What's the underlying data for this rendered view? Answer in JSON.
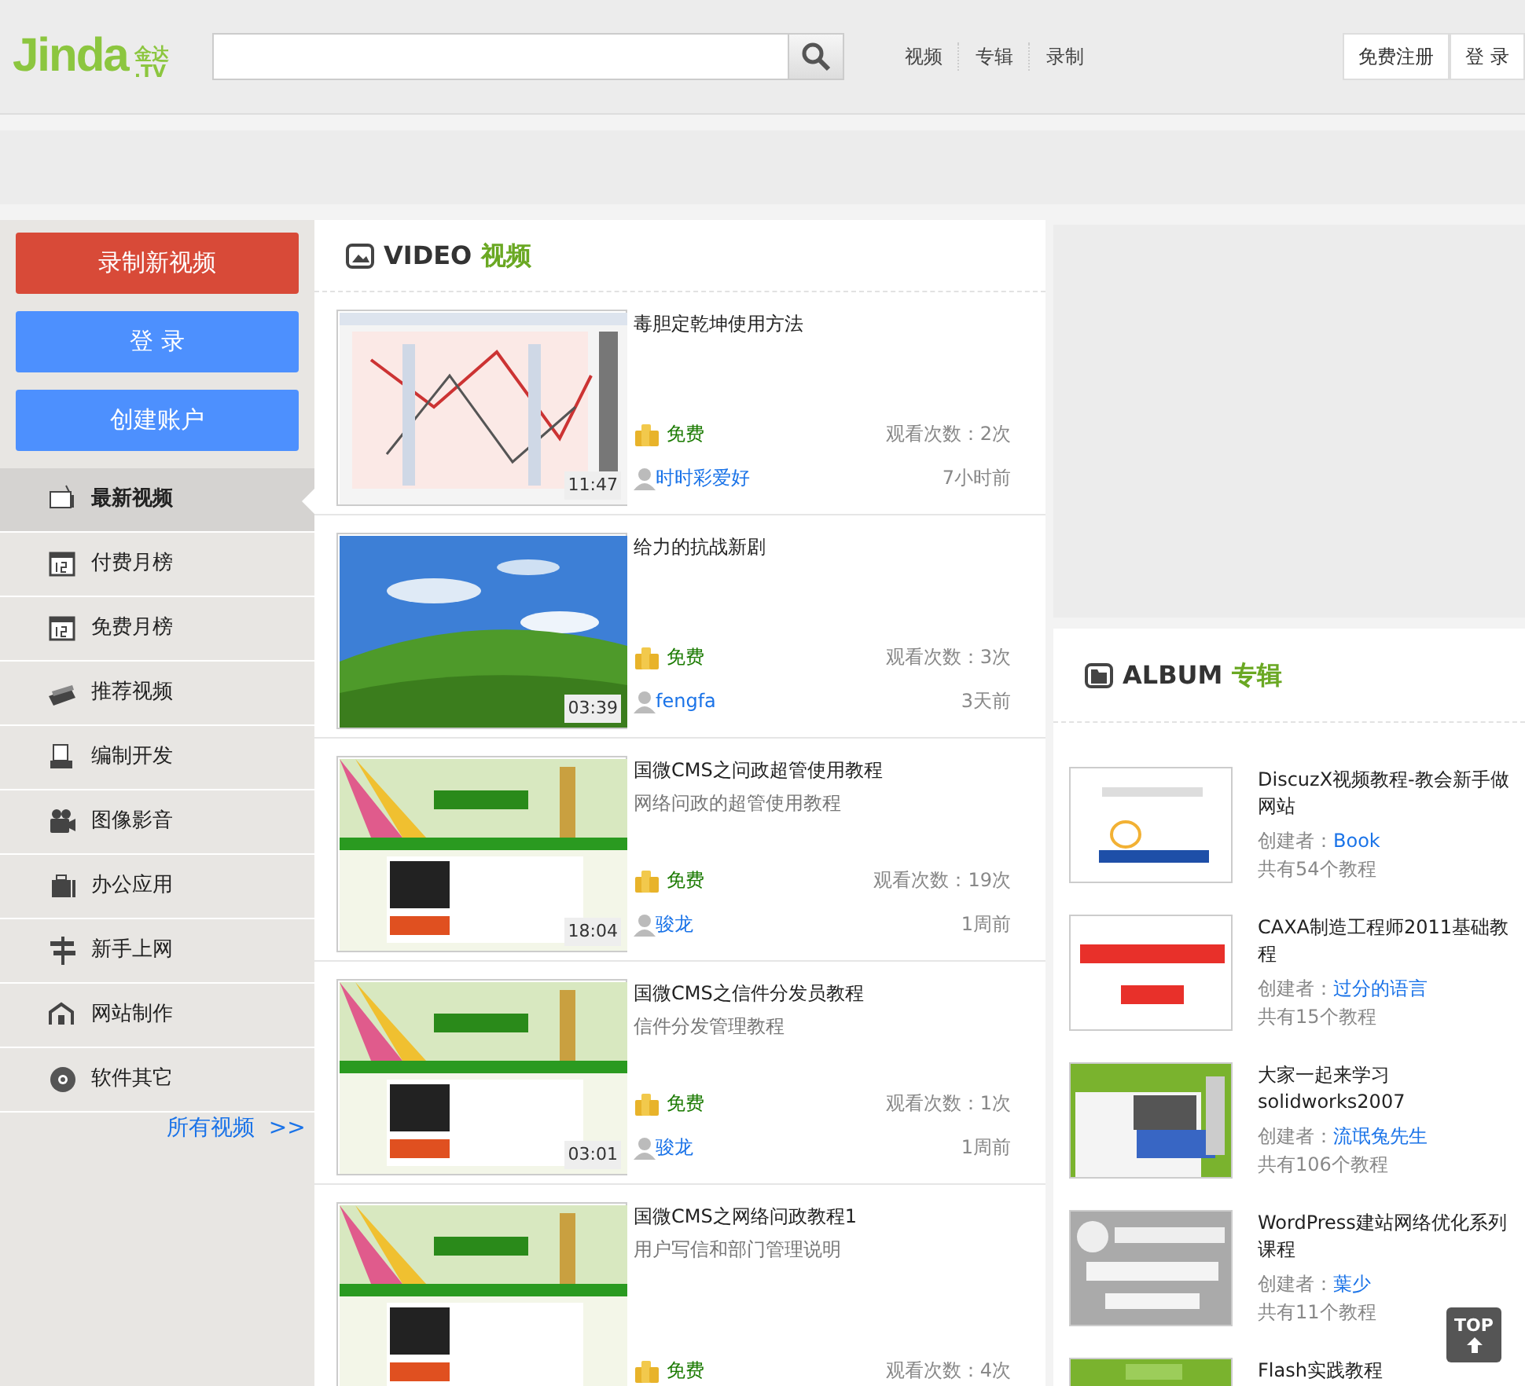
{
  "header": {
    "logo": "Jinda",
    "logo_sub": "金达",
    "logo_tv": ".TV",
    "nav": [
      "视频",
      "专辑",
      "录制"
    ],
    "buttons": [
      "免费注册",
      "登 录"
    ]
  },
  "sidebar": {
    "actions": [
      {
        "label": "录制新视频",
        "kind": "danger"
      },
      {
        "label": "登 录",
        "kind": "primary"
      },
      {
        "label": "创建账户",
        "kind": "primary"
      }
    ],
    "items": [
      {
        "label": "最新视频",
        "selected": true
      },
      {
        "label": "付费月榜",
        "selected": false
      },
      {
        "label": "免费月榜",
        "selected": false
      },
      {
        "label": "推荐视频",
        "selected": false
      },
      {
        "label": "编制开发",
        "selected": false
      },
      {
        "label": "图像影音",
        "selected": false
      },
      {
        "label": "办公应用",
        "selected": false
      },
      {
        "label": "新手上网",
        "selected": false
      },
      {
        "label": "网站制作",
        "selected": false
      },
      {
        "label": "软件其它",
        "selected": false
      }
    ],
    "more_link": "所有视频  >>"
  },
  "videos": {
    "title_en": "VIDEO",
    "title_zh": "视频",
    "items": [
      {
        "title": "毒胆定乾坤使用方法",
        "duration": "11:47",
        "price": "免费",
        "views": "观看次数：2次",
        "author": "时时彩爱好",
        "time": "7小时前"
      },
      {
        "title": "给力的抗战新剧",
        "duration": "03:39",
        "price": "免费",
        "views": "观看次数：3次",
        "author": "fengfa",
        "time": "3天前"
      },
      {
        "title": "国微CMS之问政超管使用教程",
        "desc": "网络问政的超管使用教程",
        "duration": "18:04",
        "price": "免费",
        "views": "观看次数：19次",
        "author": "骏龙",
        "time": "1周前"
      },
      {
        "title": "国微CMS之信件分发员教程",
        "desc": "信件分发管理教程",
        "duration": "03:01",
        "price": "免费",
        "views": "观看次数：1次",
        "author": "骏龙",
        "time": "1周前"
      },
      {
        "title": "国微CMS之网络问政教程1",
        "desc": "用户写信和部门管理说明",
        "price": "免费",
        "views": "观看次数：4次"
      }
    ]
  },
  "albums": {
    "title_en": "ALBUM",
    "title_zh": "专辑",
    "items": [
      {
        "title": "DiscuzX视频教程-教会新手做网站",
        "creator_label": "创建者：",
        "creator": "Book",
        "count": "共有54个教程"
      },
      {
        "title": "CAXA制造工程师2011基础教程",
        "creator_label": "创建者：",
        "creator": "过分的语言",
        "count": "共有15个教程"
      },
      {
        "title": "大家一起来学习solidworks2007",
        "creator_label": "创建者：",
        "creator": "流氓兔先生",
        "count": "共有106个教程"
      },
      {
        "title": "WordPress建站网络优化系列课程",
        "creator_label": "创建者：",
        "creator": "葉少",
        "count": "共有11个教程"
      },
      {
        "title": "Flash实践教程"
      }
    ]
  },
  "top_button": "TOP"
}
